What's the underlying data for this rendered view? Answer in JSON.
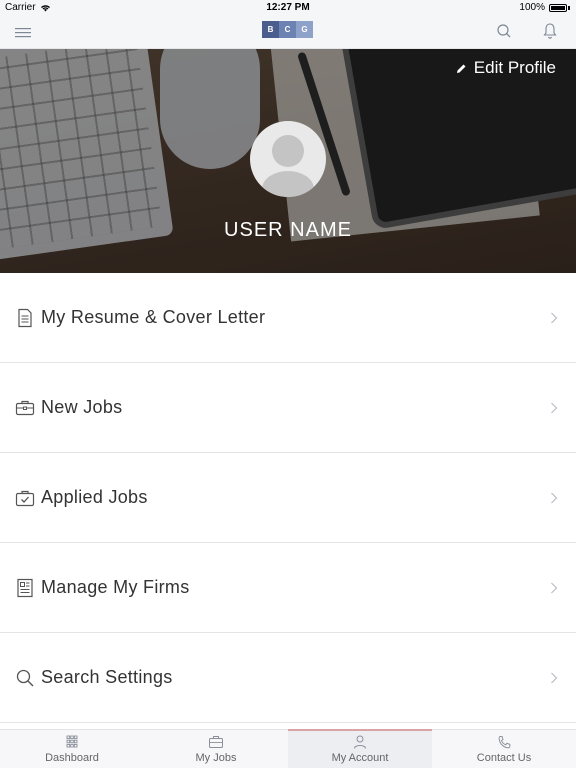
{
  "status_bar": {
    "carrier": "Carrier",
    "time": "12:27 PM",
    "battery": "100%"
  },
  "nav": {
    "logo_letters": [
      "B",
      "C",
      "G"
    ],
    "logo_colors": [
      "#4a5d8c",
      "#6c82b2",
      "#8ea1c8"
    ],
    "icons": {
      "menu": "hamburger-icon",
      "search": "search-icon",
      "notifications": "bell-icon"
    }
  },
  "profile": {
    "edit_label": "Edit Profile",
    "user_name": "USER NAME"
  },
  "menu_items": [
    {
      "label": "My Resume & Cover Letter",
      "icon": "document-icon"
    },
    {
      "label": "New Jobs",
      "icon": "briefcase-icon"
    },
    {
      "label": "Applied Jobs",
      "icon": "briefcase-check-icon"
    },
    {
      "label": "Manage My Firms",
      "icon": "firms-icon"
    },
    {
      "label": "Search Settings",
      "icon": "search-icon"
    }
  ],
  "tabs": [
    {
      "label": "Dashboard",
      "icon": "grid-icon",
      "active": false
    },
    {
      "label": "My Jobs",
      "icon": "briefcase-icon",
      "active": false
    },
    {
      "label": "My Account",
      "icon": "person-icon",
      "active": true
    },
    {
      "label": "Contact Us",
      "icon": "phone-icon",
      "active": false
    }
  ],
  "colors": {
    "accent": "#d9a3a8",
    "text": "#333333",
    "divider": "#e2e4e8"
  }
}
